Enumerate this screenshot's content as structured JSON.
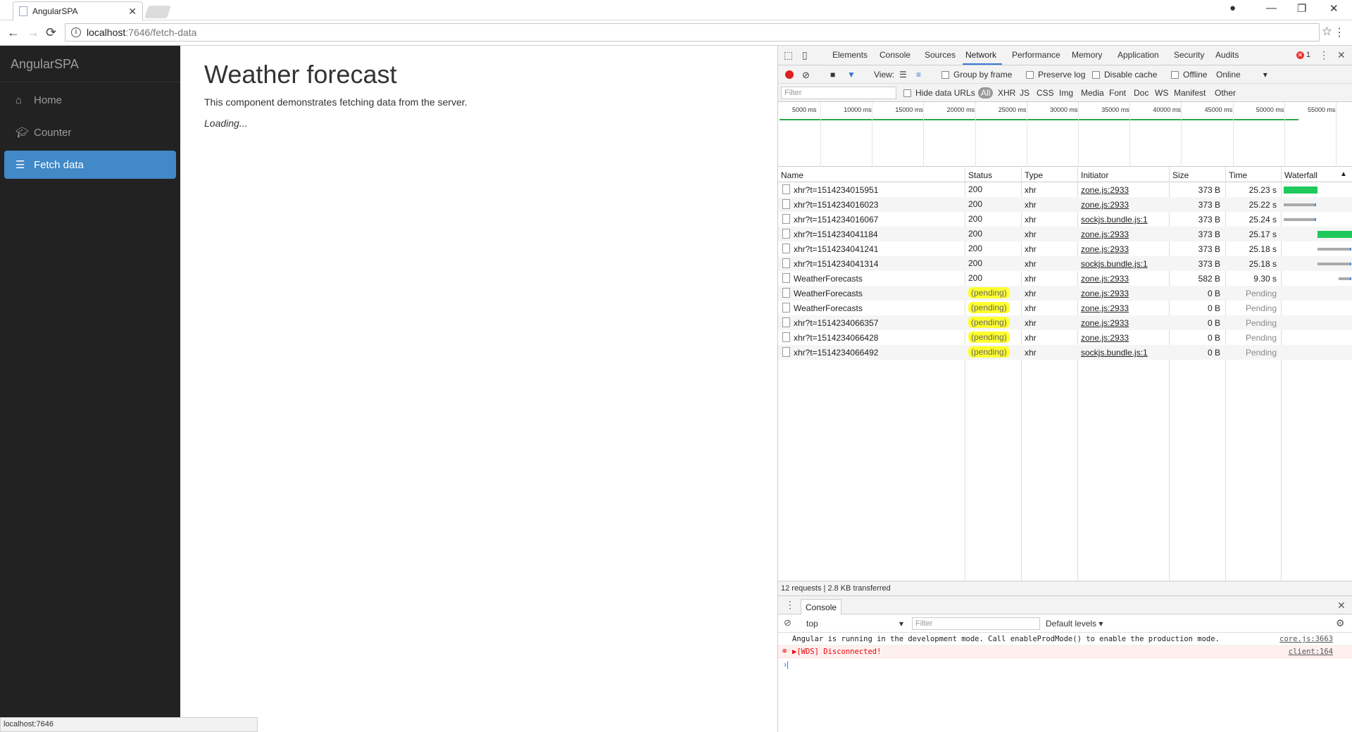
{
  "browser": {
    "tab_title": "AngularSPA",
    "tab_close": "✕",
    "url_host": "localhost",
    "url_path": ":7646/fetch-data",
    "status_url": "localhost:7646"
  },
  "sidebar": {
    "brand": "AngularSPA",
    "items": [
      {
        "label": "Home",
        "icon": "home-icon"
      },
      {
        "label": "Counter",
        "icon": "graduation-cap-icon"
      },
      {
        "label": "Fetch data",
        "icon": "list-icon",
        "active": true
      }
    ]
  },
  "main": {
    "title": "Weather forecast",
    "description": "This component demonstrates fetching data from the server.",
    "loading": "Loading..."
  },
  "devtools": {
    "tabs": [
      "Elements",
      "Console",
      "Sources",
      "Network",
      "Performance",
      "Memory",
      "Application",
      "Security",
      "Audits"
    ],
    "active_tab": "Network",
    "error_count": "1",
    "toolbar": {
      "view_label": "View:",
      "group_by_frame": "Group by frame",
      "preserve_log": "Preserve log",
      "disable_cache": "Disable cache",
      "offline": "Offline",
      "throttling": "Online"
    },
    "filter": {
      "placeholder": "Filter",
      "hide_data_urls": "Hide data URLs",
      "types": [
        "All",
        "XHR",
        "JS",
        "CSS",
        "Img",
        "Media",
        "Font",
        "Doc",
        "WS",
        "Manifest",
        "Other"
      ]
    },
    "timeline_ticks": [
      "5000 ms",
      "10000 ms",
      "15000 ms",
      "20000 ms",
      "25000 ms",
      "30000 ms",
      "35000 ms",
      "40000 ms",
      "45000 ms",
      "50000 ms",
      "55000 ms"
    ],
    "columns": [
      "Name",
      "Status",
      "Type",
      "Initiator",
      "Size",
      "Time",
      "Waterfall"
    ],
    "requests": [
      {
        "name": "xhr?t=1514234015951",
        "status": "200",
        "type": "xhr",
        "initiator": "zone.js:2933",
        "size": "373 B",
        "time": "25.23 s",
        "pending": false
      },
      {
        "name": "xhr?t=1514234016023",
        "status": "200",
        "type": "xhr",
        "initiator": "zone.js:2933",
        "size": "373 B",
        "time": "25.22 s",
        "pending": false
      },
      {
        "name": "xhr?t=1514234016067",
        "status": "200",
        "type": "xhr",
        "initiator": "sockjs.bundle.js:1",
        "size": "373 B",
        "time": "25.24 s",
        "pending": false
      },
      {
        "name": "xhr?t=1514234041184",
        "status": "200",
        "type": "xhr",
        "initiator": "zone.js:2933",
        "size": "373 B",
        "time": "25.17 s",
        "pending": false
      },
      {
        "name": "xhr?t=1514234041241",
        "status": "200",
        "type": "xhr",
        "initiator": "zone.js:2933",
        "size": "373 B",
        "time": "25.18 s",
        "pending": false
      },
      {
        "name": "xhr?t=1514234041314",
        "status": "200",
        "type": "xhr",
        "initiator": "sockjs.bundle.js:1",
        "size": "373 B",
        "time": "25.18 s",
        "pending": false
      },
      {
        "name": "WeatherForecasts",
        "status": "200",
        "type": "xhr",
        "initiator": "zone.js:2933",
        "size": "582 B",
        "time": "9.30 s",
        "pending": false
      },
      {
        "name": "WeatherForecasts",
        "status": "(pending)",
        "type": "xhr",
        "initiator": "zone.js:2933",
        "size": "0 B",
        "time": "Pending",
        "pending": true
      },
      {
        "name": "WeatherForecasts",
        "status": "(pending)",
        "type": "xhr",
        "initiator": "zone.js:2933",
        "size": "0 B",
        "time": "Pending",
        "pending": true
      },
      {
        "name": "xhr?t=1514234066357",
        "status": "(pending)",
        "type": "xhr",
        "initiator": "zone.js:2933",
        "size": "0 B",
        "time": "Pending",
        "pending": true
      },
      {
        "name": "xhr?t=1514234066428",
        "status": "(pending)",
        "type": "xhr",
        "initiator": "zone.js:2933",
        "size": "0 B",
        "time": "Pending",
        "pending": true
      },
      {
        "name": "xhr?t=1514234066492",
        "status": "(pending)",
        "type": "xhr",
        "initiator": "sockjs.bundle.js:1",
        "size": "0 B",
        "time": "Pending",
        "pending": true
      }
    ],
    "summary": "12 requests  |  2.8 KB transferred",
    "drawer": {
      "tab": "Console",
      "context": "top",
      "filter_placeholder": "Filter",
      "levels": "Default levels ▾",
      "messages": [
        {
          "text": "Angular is running in the development mode. Call enableProdMode() to enable the production mode.",
          "source": "core.js:3663",
          "error": false
        },
        {
          "text": "▶[WDS] Disconnected!",
          "source": "client:164",
          "error": true
        }
      ]
    }
  }
}
